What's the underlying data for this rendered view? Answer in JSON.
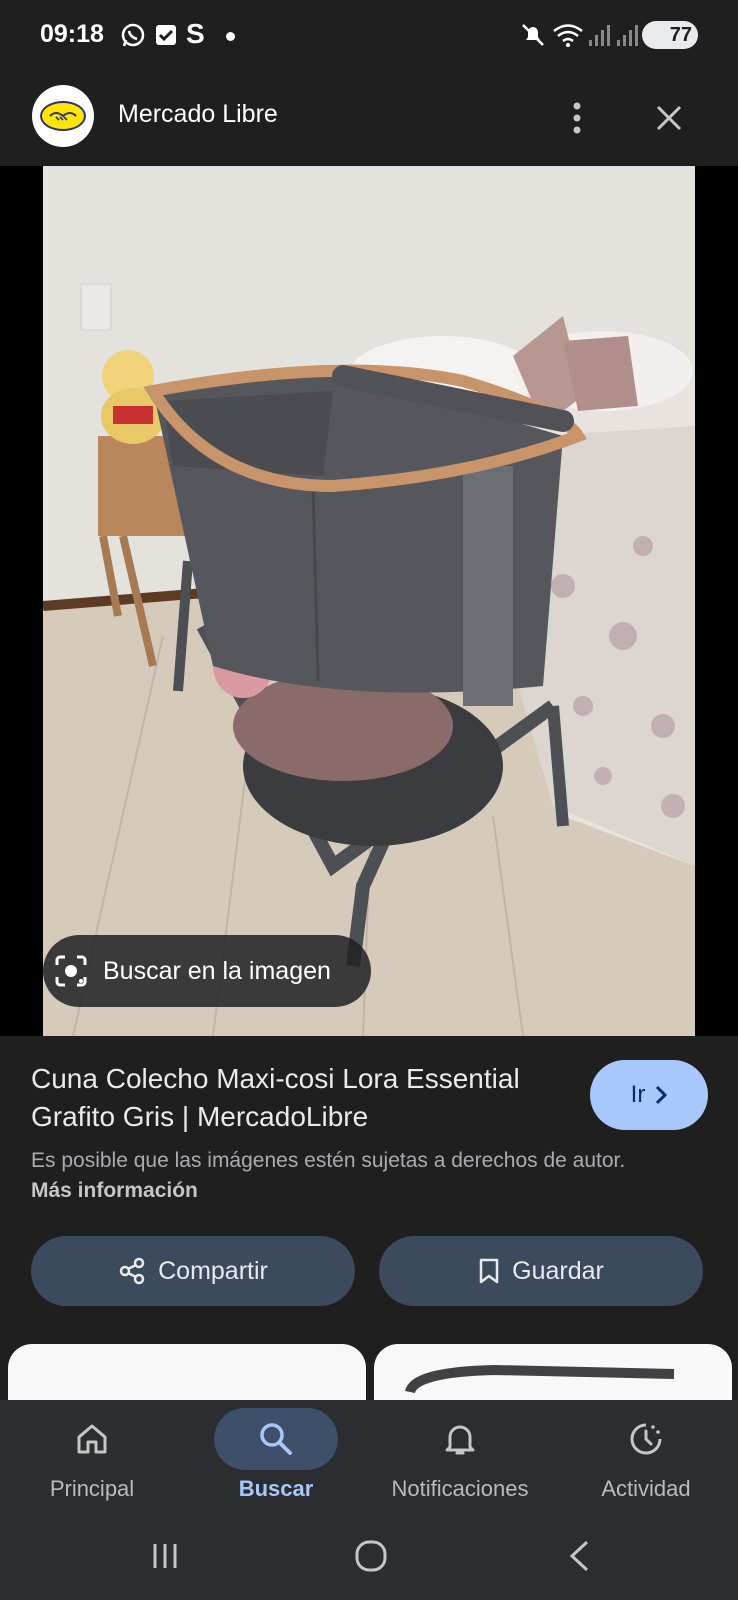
{
  "status_bar": {
    "time": "09:18",
    "battery": "77",
    "left_icons": [
      "whatsapp-icon",
      "check-box-icon",
      "s-app-icon",
      "dot-icon"
    ],
    "right_icons": [
      "mute-icon",
      "wifi-icon",
      "signal-icon",
      "signal-icon-2"
    ]
  },
  "header": {
    "site_name": "Mercado Libre",
    "menu_icon": "more-vertical-icon",
    "close_icon": "close-icon"
  },
  "image": {
    "lens_label": "Buscar en la imagen"
  },
  "result": {
    "title": "Cuna Colecho Maxi-cosi Lora Essential Grafito Gris | MercadoLibre",
    "go_label": "Ir",
    "notice_text": "Es posible que las imágenes estén sujetas a derechos de autor.",
    "notice_link": "Más información"
  },
  "actions": {
    "share_label": "Compartir",
    "save_label": "Guardar"
  },
  "bottom_nav": {
    "items": [
      {
        "label": "Principal",
        "icon": "home-icon"
      },
      {
        "label": "Buscar",
        "icon": "search-icon",
        "active": true
      },
      {
        "label": "Notificaciones",
        "icon": "bell-icon"
      },
      {
        "label": "Actividad",
        "icon": "activity-icon"
      }
    ]
  },
  "colors": {
    "background": "#1f1f1f",
    "accent": "#a8c7fa",
    "button_bg": "#3b4a5c",
    "nav_bg": "#2b2d30"
  }
}
